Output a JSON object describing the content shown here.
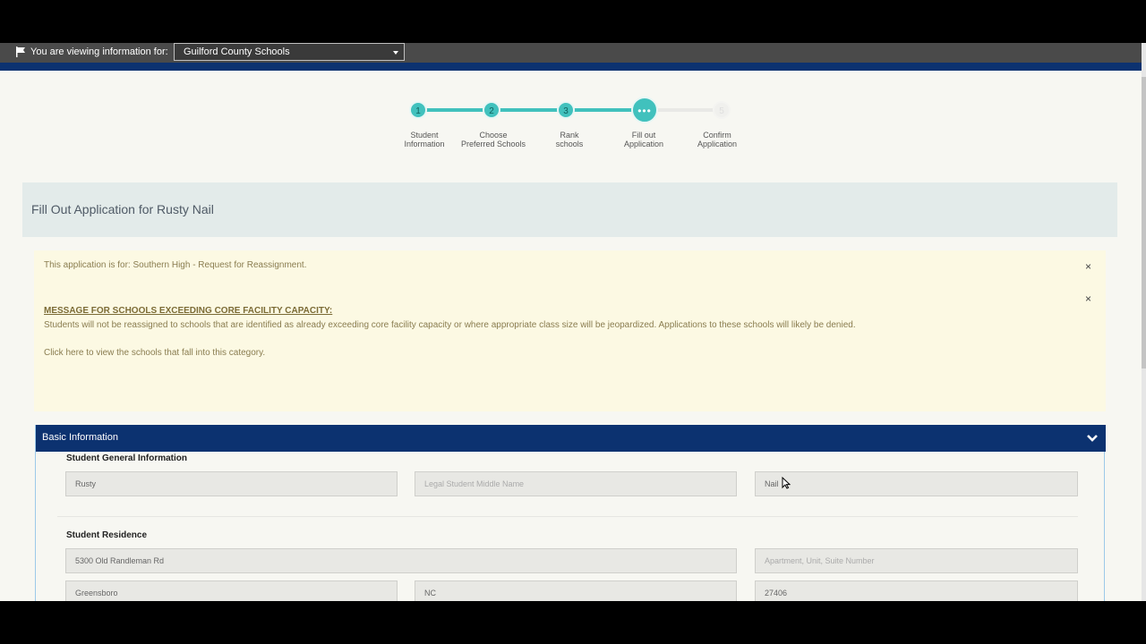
{
  "topbar": {
    "viewing_label": "You are viewing information for:",
    "district": "Guilford County Schools"
  },
  "stepper": {
    "steps": [
      {
        "number": "1",
        "label_line1": "Student",
        "label_line2": "Information",
        "state": "done"
      },
      {
        "number": "2",
        "label_line1": "Choose",
        "label_line2": "Preferred Schools",
        "state": "done"
      },
      {
        "number": "3",
        "label_line1": "Rank",
        "label_line2": "schools",
        "state": "done"
      },
      {
        "number": "•••",
        "label_line1": "Fill out",
        "label_line2": "Application",
        "state": "current"
      },
      {
        "number": "5",
        "label_line1": "Confirm",
        "label_line2": "Application",
        "state": "future"
      }
    ],
    "accent_color": "#41c1bd"
  },
  "page": {
    "title": "Fill Out Application for Rusty Nail"
  },
  "alert": {
    "application_for": "This application is for: Southern High - Request for Reassignment.",
    "close": "×",
    "heading": "MESSAGE FOR SCHOOLS EXCEEDING CORE FACILITY CAPACITY:",
    "body": "Students will not be reassigned to schools that are identified as already exceeding core facility capacity or where appropriate class size will be jeopardized. Applications to these schools will likely be denied.",
    "link_text": "Click here to view the schools that fall into this category."
  },
  "basic_info": {
    "title": "Basic Information",
    "general_label": "Student General Information",
    "first_name": "Rusty",
    "middle_name_placeholder": "Legal Student Middle Name",
    "last_name": "Nail",
    "residence_label": "Student Residence",
    "street": "5300 Old Randleman Rd",
    "apartment_placeholder": "Apartment, Unit, Suite Number",
    "city": "Greensboro",
    "state": "NC",
    "zip": "27406"
  },
  "colors": {
    "navy": "#0c3270",
    "alert_bg": "#fcf9e3",
    "header_bg": "#e3ebea"
  }
}
